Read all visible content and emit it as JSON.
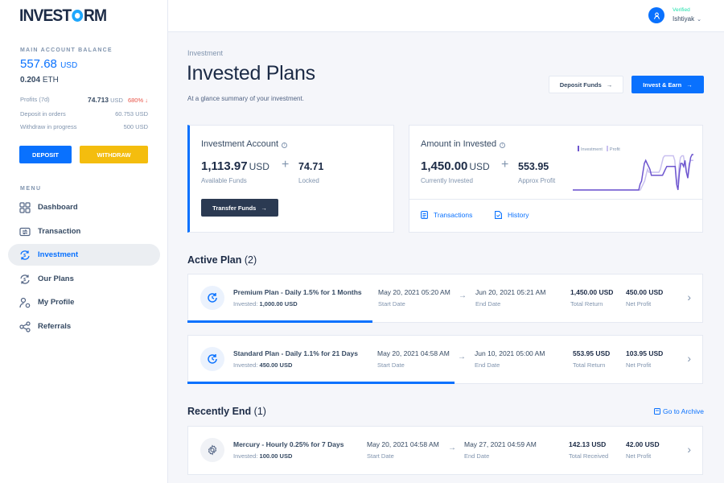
{
  "brand": {
    "name_pre": "INVEST",
    "name_post": "RM"
  },
  "sidebar": {
    "balance_label": "MAIN ACCOUNT BALANCE",
    "balance_value": "557.68",
    "balance_currency": "USD",
    "eth_value": "0.204",
    "eth_currency": "ETH",
    "rows": [
      {
        "label": "Profits (7d)",
        "value": "74.713",
        "currency": "USD",
        "change": "680% ↓"
      },
      {
        "label": "Deposit in orders",
        "value_text": "60.753 USD"
      },
      {
        "label": "Withdraw in progress",
        "value_text": "500 USD"
      }
    ],
    "deposit_label": "DEPOSIT",
    "withdraw_label": "WITHDRAW",
    "menu_label": "MENU",
    "menu": [
      {
        "label": "Dashboard",
        "icon": "grid-icon"
      },
      {
        "label": "Transaction",
        "icon": "transaction-icon"
      },
      {
        "label": "Investment",
        "icon": "investment-icon",
        "active": true
      },
      {
        "label": "Our Plans",
        "icon": "plans-icon"
      },
      {
        "label": "My Profile",
        "icon": "profile-icon"
      },
      {
        "label": "Referrals",
        "icon": "share-icon"
      }
    ]
  },
  "header": {
    "verified": "Verified",
    "username": "Ishtiyak"
  },
  "page": {
    "breadcrumb": "Investment",
    "title": "Invested Plans",
    "subtitle": "At a glance summary of your investment.",
    "deposit_funds_label": "Deposit Funds",
    "invest_earn_label": "Invest & Earn"
  },
  "investment_account": {
    "title": "Investment Account",
    "available": "1,113.97",
    "currency": "USD",
    "available_label": "Available Funds",
    "locked": "74.71",
    "locked_label": "Locked",
    "transfer_label": "Transfer Funds"
  },
  "amount_invested": {
    "title": "Amount in Invested",
    "invested": "1,450.00",
    "currency": "USD",
    "invested_label": "Currently Invested",
    "profit": "553.95",
    "profit_label": "Approx Profit",
    "transactions_label": "Transactions",
    "history_label": "History",
    "legend": {
      "investment": "Investment",
      "profit": "Profit"
    },
    "colors": {
      "investment": "#6e56cf",
      "profit": "#c9c0ef"
    },
    "spark": {
      "investment": [
        0,
        0,
        0,
        0,
        0,
        0,
        0,
        0,
        0,
        0,
        0,
        0,
        0,
        0,
        0,
        0,
        0,
        0,
        0,
        0,
        0,
        0,
        0,
        0,
        0,
        0,
        0,
        0,
        0,
        0,
        0,
        0,
        0,
        0,
        0,
        0,
        0,
        0,
        0,
        0,
        0,
        0,
        0,
        0,
        0,
        0,
        0,
        0,
        10,
        15,
        30,
        45,
        50,
        45,
        40,
        35,
        25,
        25,
        25,
        25,
        25,
        25,
        25,
        25,
        25,
        30,
        35,
        40,
        40,
        40,
        40,
        40,
        40,
        40,
        10,
        0,
        30,
        45,
        45,
        40,
        50,
        30,
        20,
        40,
        55,
        60,
        60
      ],
      "profit": [
        0,
        0,
        0,
        0,
        0,
        0,
        0,
        0,
        0,
        0,
        0,
        0,
        0,
        0,
        0,
        0,
        0,
        0,
        0,
        0,
        0,
        0,
        0,
        0,
        0,
        0,
        0,
        0,
        0,
        0,
        0,
        0,
        0,
        0,
        0,
        0,
        0,
        0,
        0,
        0,
        0,
        0,
        0,
        0,
        0,
        0,
        0,
        0,
        5,
        10,
        15,
        25,
        35,
        30,
        30,
        30,
        30,
        30,
        30,
        30,
        30,
        35,
        45,
        55,
        58,
        58,
        58,
        58,
        58,
        58,
        58,
        50,
        20,
        10,
        40,
        55,
        58,
        58,
        45,
        30,
        25,
        45,
        50,
        50,
        50
      ]
    }
  },
  "active_plans": {
    "title": "Active Plan",
    "count": "(2)",
    "items": [
      {
        "name": "Premium Plan - Daily 1.5% for 1 Months",
        "invested_label": "Invested:",
        "invested": "1,000.00 USD",
        "start": "May 20, 2021 05:20 AM",
        "start_label": "Start Date",
        "end": "Jun 20, 2021 05:21 AM",
        "end_label": "End Date",
        "total": "1,450.00 USD",
        "total_label": "Total Return",
        "profit": "450.00 USD",
        "profit_label": "Net Profit",
        "progress": 0.36
      },
      {
        "name": "Standard Plan - Daily 1.1% for 21 Days",
        "invested_label": "Invested:",
        "invested": "450.00 USD",
        "start": "May 20, 2021 04:58 AM",
        "start_label": "Start Date",
        "end": "Jun 10, 2021 05:00 AM",
        "end_label": "End Date",
        "total": "553.95 USD",
        "total_label": "Total Return",
        "profit": "103.95 USD",
        "profit_label": "Net Profit",
        "progress": 0.52
      }
    ]
  },
  "recent": {
    "title": "Recently End",
    "count": "(1)",
    "archive_label": "Go to Archive",
    "items": [
      {
        "name": "Mercury - Hourly 0.25% for 7 Days",
        "invested_label": "Invested:",
        "invested": "100.00 USD",
        "start": "May 20, 2021 04:58 AM",
        "start_label": "Start Date",
        "end": "May 27, 2021 04:59 AM",
        "end_label": "End Date",
        "total": "142.13 USD",
        "total_label": "Total Received",
        "profit": "42.00 USD",
        "profit_label": "Net Profit"
      }
    ]
  },
  "colors": {
    "primary": "#0971fe",
    "warning": "#f4bd0e",
    "success": "#1ee0ac",
    "danger": "#e85347",
    "dark_button": "#2b3a52"
  }
}
